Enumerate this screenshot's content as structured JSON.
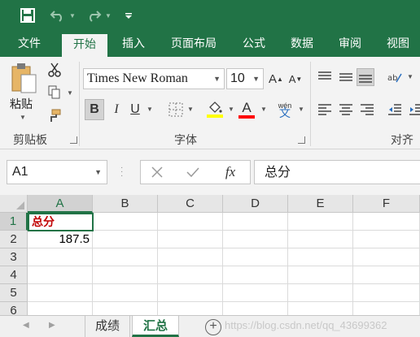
{
  "qat": {
    "save_icon": "save-icon",
    "undo_icon": "undo-icon",
    "redo_icon": "redo-icon",
    "customize_icon": "customize-qat-icon"
  },
  "ribbon_tabs": [
    "文件",
    "开始",
    "插入",
    "页面布局",
    "公式",
    "数据",
    "审阅",
    "视图"
  ],
  "active_tab": "开始",
  "clipboard": {
    "paste_label": "粘贴",
    "group_label": "剪贴板"
  },
  "font": {
    "name": "Times New Roman",
    "size": "10",
    "group_label": "字体",
    "bold": "B",
    "italic": "I",
    "underline": "U",
    "grow": "A",
    "shrink": "A",
    "font_color_letter": "A",
    "wen": "wén",
    "wen_char": "文"
  },
  "alignment": {
    "group_label": "对齐方"
  },
  "formula_bar": {
    "name_box": "A1",
    "fx": "fx",
    "value": "总分"
  },
  "columns": [
    "A",
    "B",
    "C",
    "D",
    "E",
    "F"
  ],
  "rows": [
    "1",
    "2",
    "3",
    "4",
    "5",
    "6"
  ],
  "cells": {
    "A1": "总分",
    "A2": "187.5"
  },
  "sheets": [
    "成绩",
    "汇总"
  ],
  "active_sheet": "汇总",
  "watermark": "https://blog.csdn.net/qq_43699362",
  "colors": {
    "accent": "#217346",
    "ribbon_bg": "#f3f3f3",
    "red_text": "#c00000"
  }
}
